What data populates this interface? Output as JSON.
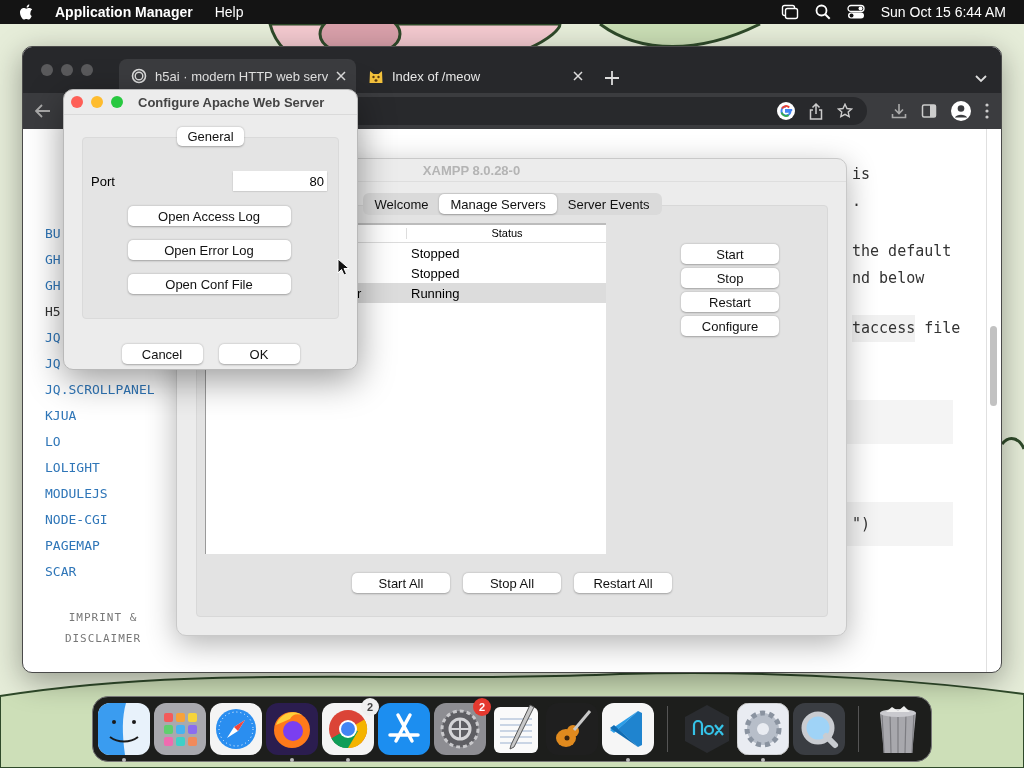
{
  "menubar": {
    "app_name": "Application Manager",
    "menus": [
      "Help"
    ],
    "clock": "Sun Oct 15  6:44 AM"
  },
  "browser": {
    "tabs": [
      {
        "title": "h5ai · modern HTTP web serv",
        "selected": true
      },
      {
        "title": "Index of /meow",
        "selected": false
      }
    ],
    "sidebar_links": [
      {
        "text": "BU",
        "current": false
      },
      {
        "text": "GH",
        "current": false
      },
      {
        "text": "GH",
        "current": false
      },
      {
        "text": "H5",
        "current": true
      },
      {
        "text": "JQ",
        "current": false
      },
      {
        "text": "JQ",
        "current": false
      },
      {
        "text": "JQ.SCROLLPANEL",
        "current": false
      },
      {
        "text": "KJUA",
        "current": false
      },
      {
        "text": "LO",
        "current": false
      },
      {
        "text": "LOLIGHT",
        "current": false
      },
      {
        "text": "MODULEJS",
        "current": false
      },
      {
        "text": "NODE-CGI",
        "current": false
      },
      {
        "text": "PAGEMAP",
        "current": false
      },
      {
        "text": "SCAR",
        "current": false
      }
    ],
    "footer_link": "IMPRINT & DISCLAIMER",
    "content": [
      {
        "kind": "paragraph",
        "lines": [
          {
            "text": "is"
          },
          {
            "text": "."
          }
        ]
      },
      {
        "kind": "paragraph",
        "lines": [
          {
            "text": "the default"
          },
          {
            "text": "nd below"
          }
        ]
      },
      {
        "kind": "paragraph",
        "lines": [
          {
            "code": "taccess",
            "text": "file"
          }
        ]
      },
      {
        "kind": "codeblock"
      },
      {
        "kind": "codeblock",
        "text": "\")"
      }
    ]
  },
  "xampp": {
    "title": "XAMPP 8.0.28-0",
    "tabs": [
      {
        "label": "Welcome",
        "selected": false
      },
      {
        "label": "Manage Servers",
        "selected": true
      },
      {
        "label": "Server Events",
        "selected": false
      }
    ],
    "status_header": "Status",
    "rows": [
      {
        "status": "Stopped",
        "selected": false
      },
      {
        "status": "Stopped",
        "selected": false
      },
      {
        "name": "r",
        "status": "Running",
        "selected": true
      }
    ],
    "server_buttons": [
      "Start",
      "Stop",
      "Restart",
      "Configure"
    ],
    "bottom_buttons": [
      "Start All",
      "Stop All",
      "Restart All"
    ]
  },
  "dialog": {
    "title": "Configure Apache Web Server",
    "tabs": [
      {
        "label": "General",
        "selected": true
      }
    ],
    "port": {
      "label": "Port",
      "value": "80"
    },
    "actions": [
      "Open Access Log",
      "Open Error Log",
      "Open Conf File"
    ],
    "buttons": [
      "Cancel",
      "OK"
    ]
  },
  "dock": {
    "items": [
      {
        "kind": "finder",
        "running": true
      },
      {
        "kind": "launchpad",
        "running": false
      },
      {
        "kind": "safari",
        "running": false
      },
      {
        "kind": "firefox",
        "running": true
      },
      {
        "kind": "chrome",
        "running": true,
        "badge": {
          "text": "2",
          "color": "#f0f0f0"
        }
      },
      {
        "kind": "appstore",
        "running": false
      },
      {
        "kind": "settings",
        "running": false,
        "badge": {
          "text": "2",
          "color": "#e5392f"
        }
      },
      {
        "kind": "textedit",
        "running": false
      },
      {
        "kind": "garageband",
        "running": false
      },
      {
        "kind": "vscode",
        "running": true
      },
      {
        "kind": "separator"
      },
      {
        "kind": "nox",
        "running": false
      },
      {
        "kind": "gearapp",
        "running": true
      },
      {
        "kind": "quicktime",
        "running": false
      },
      {
        "kind": "separator"
      },
      {
        "kind": "trash",
        "running": false
      }
    ]
  }
}
